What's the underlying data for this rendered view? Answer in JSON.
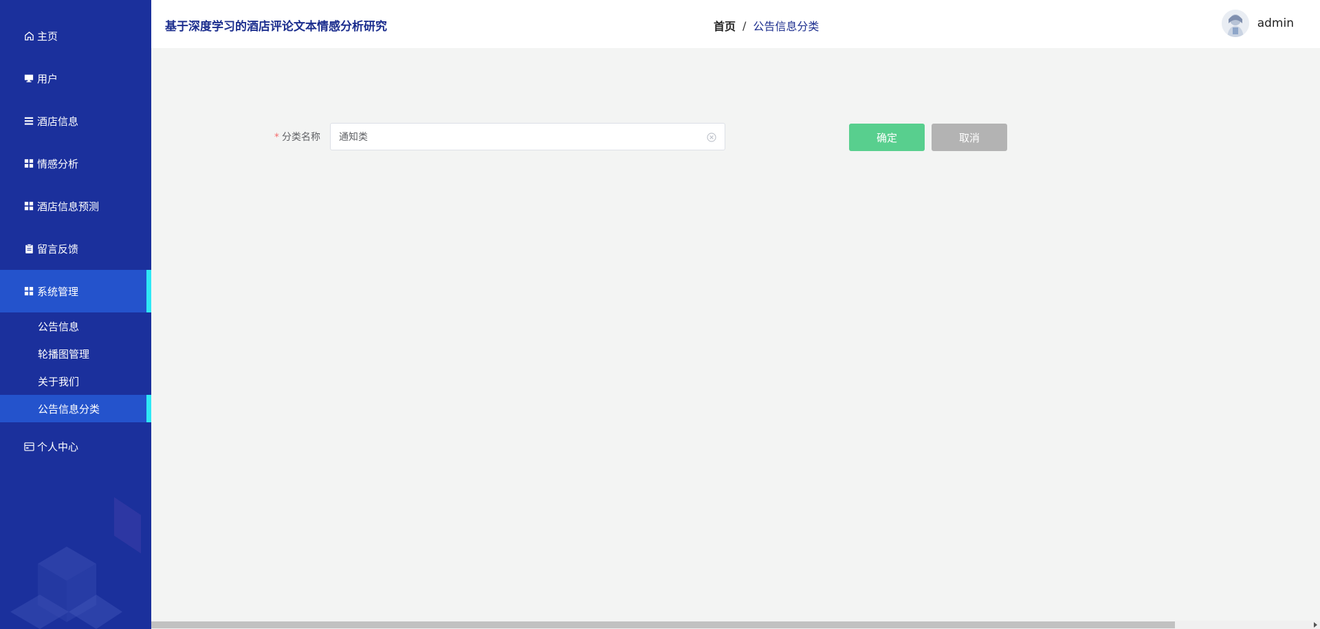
{
  "app": {
    "title": "基于深度学习的酒店评论文本情感分析研究"
  },
  "breadcrumb": {
    "home": "首页",
    "separator": "/",
    "current": "公告信息分类"
  },
  "user": {
    "name": "admin"
  },
  "sidebar": {
    "items": [
      {
        "label": "主页",
        "icon": "home-icon"
      },
      {
        "label": "用户",
        "icon": "monitor-icon"
      },
      {
        "label": "酒店信息",
        "icon": "list-icon"
      },
      {
        "label": "情感分析",
        "icon": "grid-icon"
      },
      {
        "label": "酒店信息预测",
        "icon": "grid-icon"
      },
      {
        "label": "留言反馈",
        "icon": "clipboard-icon"
      },
      {
        "label": "系统管理",
        "icon": "grid-icon"
      },
      {
        "label": "个人中心",
        "icon": "card-icon"
      }
    ],
    "submenu": [
      {
        "label": "公告信息"
      },
      {
        "label": "轮播图管理"
      },
      {
        "label": "关于我们"
      },
      {
        "label": "公告信息分类"
      }
    ]
  },
  "form": {
    "required_mark": "*",
    "label": "分类名称",
    "value": "通知类",
    "confirm_label": "确定",
    "cancel_label": "取消"
  },
  "colors": {
    "sidebar_bg": "#1b309c",
    "sidebar_active": "#2453cc",
    "active_indicator": "#2ee8f5",
    "confirm": "#58cf8e",
    "cancel": "#b3b3b3",
    "title": "#1c2e8e"
  }
}
